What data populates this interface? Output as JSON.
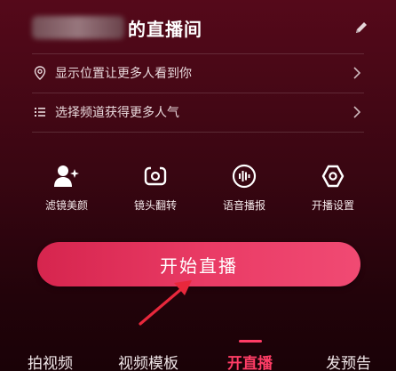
{
  "header": {
    "title_suffix": "的直播间"
  },
  "settings": {
    "location_label": "显示位置让更多人看到你",
    "channel_label": "选择频道获得更多人气"
  },
  "tools": [
    {
      "label": "滤镜美颜",
      "icon": "person-sparkle-icon"
    },
    {
      "label": "镜头翻转",
      "icon": "camera-flip-icon"
    },
    {
      "label": "语音播报",
      "icon": "voice-wave-icon"
    },
    {
      "label": "开播设置",
      "icon": "hexagon-settings-icon"
    }
  ],
  "start_button": {
    "label": "开始直播"
  },
  "bottom_tabs": [
    {
      "label": "拍视频",
      "active": false
    },
    {
      "label": "视频模板",
      "active": false
    },
    {
      "label": "开直播",
      "active": true
    },
    {
      "label": "发预告",
      "active": false
    }
  ],
  "colors": {
    "accent": "#ff3d66",
    "button_start": "#d6254e",
    "button_end": "#f04a73",
    "background_top": "#55091a",
    "annotation_arrow": "#e8283c"
  }
}
